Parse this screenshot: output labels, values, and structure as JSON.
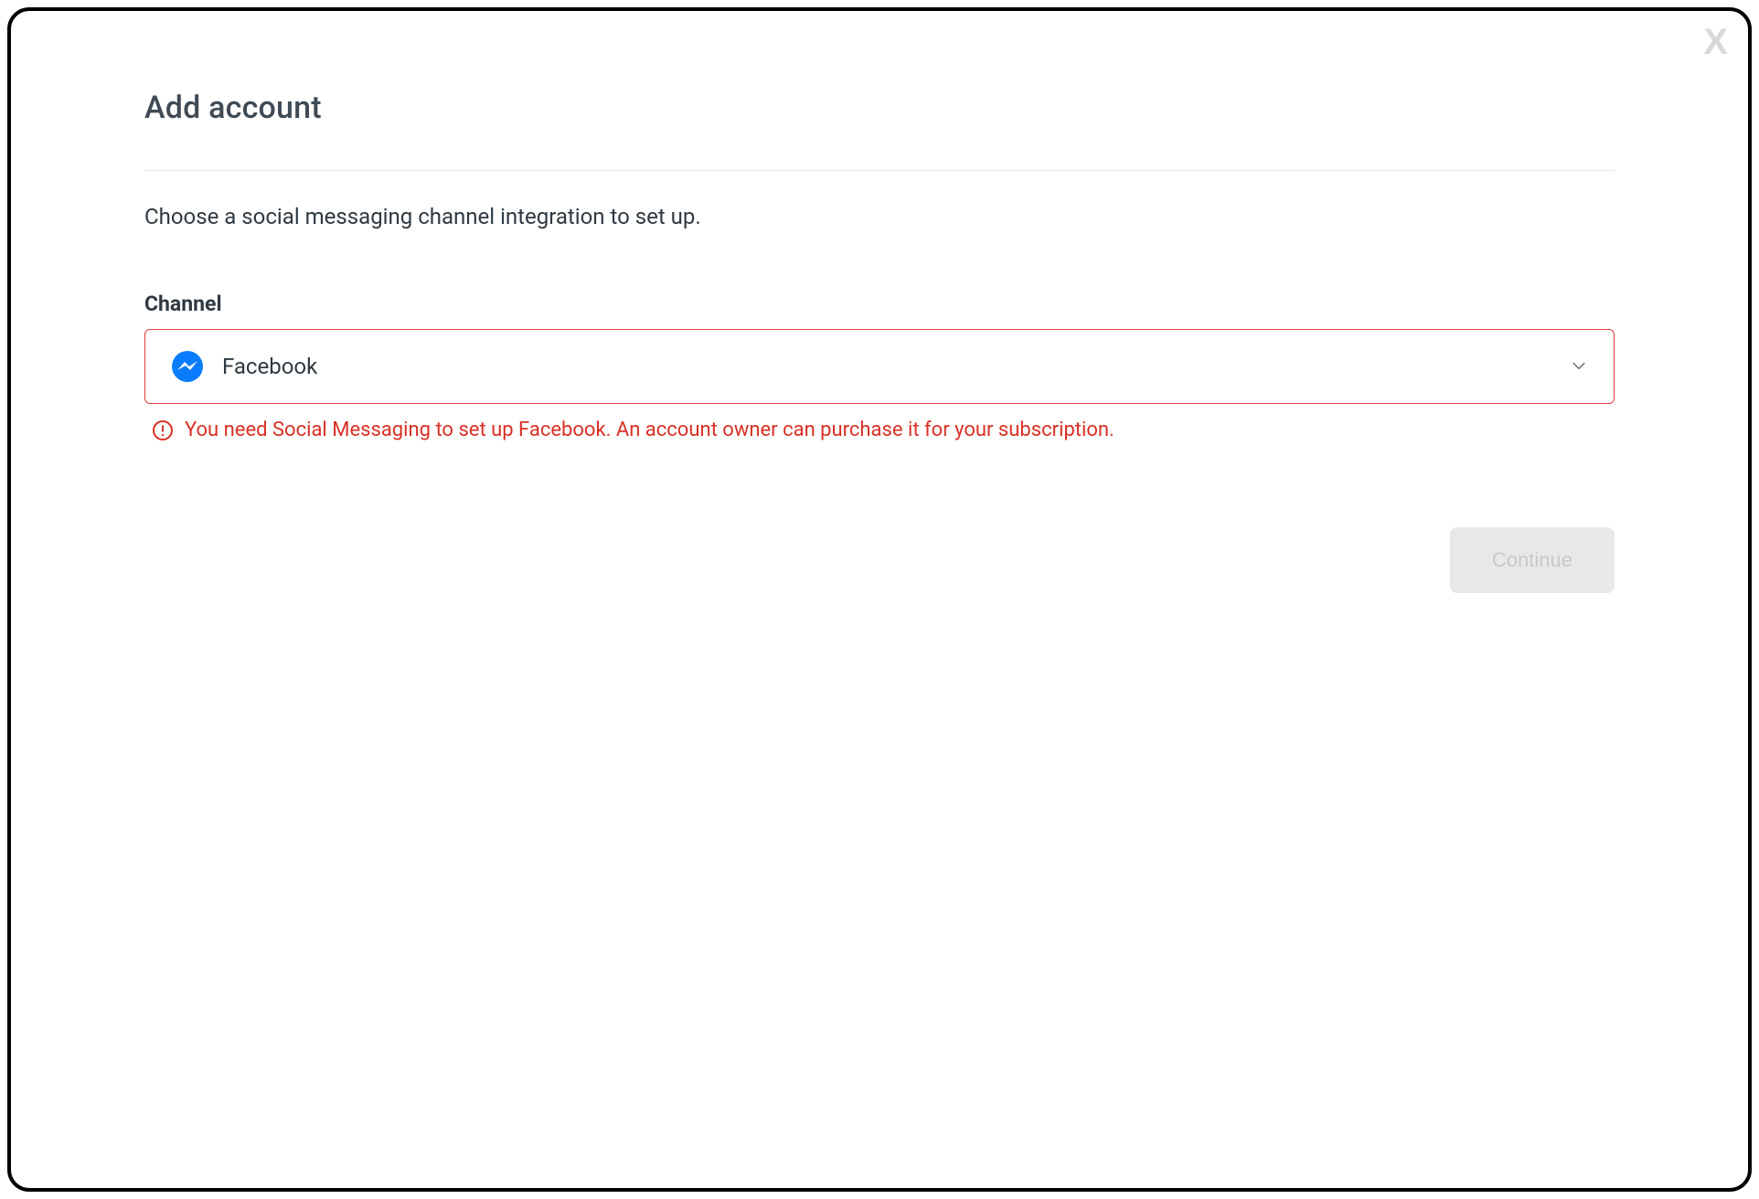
{
  "modal": {
    "title": "Add account",
    "close_label": "X",
    "description": "Choose a social messaging channel integration to set up.",
    "field": {
      "label": "Channel",
      "selected_option": "Facebook",
      "selected_icon": "facebook-messenger-icon",
      "error_message": "You need Social Messaging to set up Facebook. An account owner can purchase it for your subscription."
    },
    "actions": {
      "continue_label": "Continue",
      "continue_enabled": false
    },
    "colors": {
      "error": "#d93025",
      "title": "#3f4a55",
      "text": "#2f3941",
      "disabled_bg": "#e8e8e8",
      "disabled_fg": "#c9c9c9",
      "border_error": "#e23b3b"
    }
  }
}
